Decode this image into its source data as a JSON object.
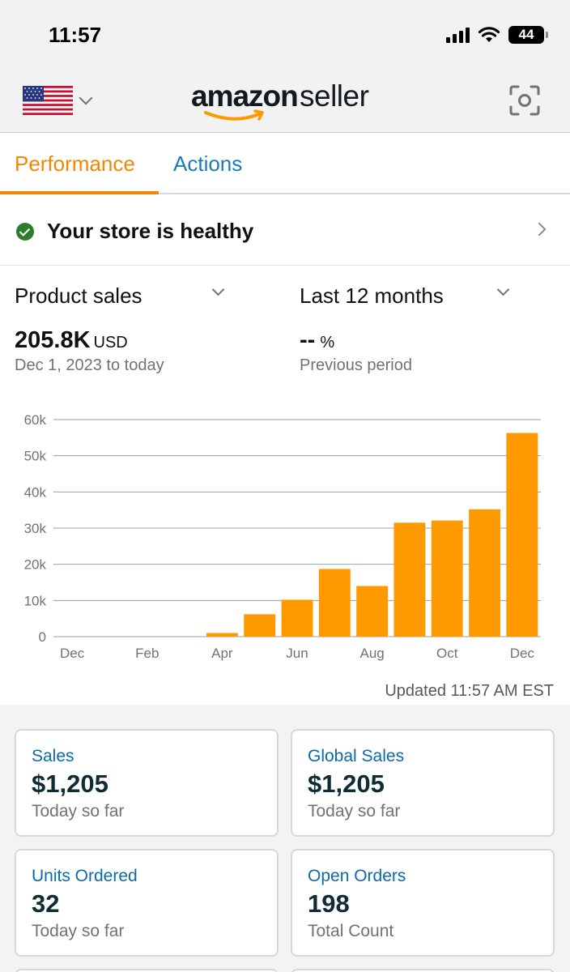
{
  "status_bar": {
    "time": "11:57",
    "battery": "44"
  },
  "header": {
    "logo_word1": "amazon",
    "logo_word2": "seller",
    "flag_icon": "us-flag-icon",
    "scan_icon": "scan-icon"
  },
  "tabs": [
    {
      "label": "Performance",
      "active": true
    },
    {
      "label": "Actions",
      "active": false
    }
  ],
  "health": {
    "text": "Your store is healthy"
  },
  "filters": {
    "metric": "Product sales",
    "period": "Last 12 months"
  },
  "summary": {
    "value": "205.8K",
    "unit": "USD",
    "date_range": "Dec 1, 2023 to today",
    "change_value": "--",
    "change_unit": "%",
    "change_caption": "Previous period"
  },
  "chart_data": {
    "type": "bar",
    "categories": [
      "Dec",
      "Jan",
      "Feb",
      "Mar",
      "Apr",
      "May",
      "Jun",
      "Jul",
      "Aug",
      "Sep",
      "Oct",
      "Nov",
      "Dec"
    ],
    "x_tick_labels": [
      "Dec",
      "Feb",
      "Apr",
      "Jun",
      "Aug",
      "Oct",
      "Dec"
    ],
    "values": [
      0,
      0,
      0,
      0,
      1000,
      6200,
      10200,
      18700,
      14000,
      31500,
      32100,
      35200,
      56300
    ],
    "y_ticks": [
      "0",
      "10k",
      "20k",
      "30k",
      "40k",
      "50k",
      "60k"
    ],
    "ylim": [
      0,
      60000
    ],
    "grid": true,
    "bar_color": "#ff9900"
  },
  "updated": "Updated 11:57 AM EST",
  "cards": [
    {
      "title": "Sales",
      "value": "$1,205",
      "sub": "Today so far"
    },
    {
      "title": "Global Sales",
      "value": "$1,205",
      "sub": "Today so far"
    },
    {
      "title": "Units Ordered",
      "value": "32",
      "sub": "Today so far"
    },
    {
      "title": "Open Orders",
      "value": "198",
      "sub": "Total Count"
    }
  ],
  "colors": {
    "accent": "#f08804",
    "link": "#1a7bb9",
    "bar": "#ff9900",
    "healthy": "#2e7d2e"
  }
}
